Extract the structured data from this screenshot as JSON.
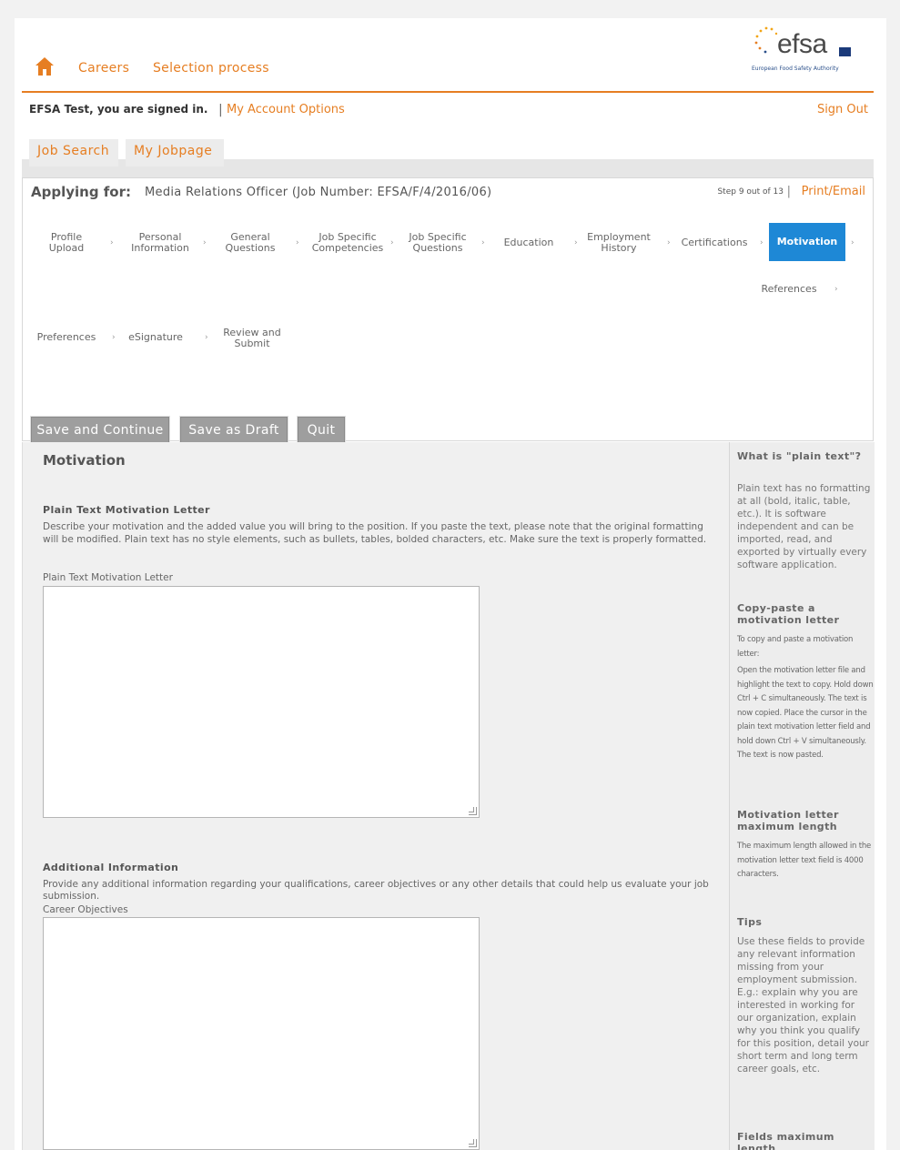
{
  "header": {
    "nav": [
      "Careers",
      "Selection process"
    ],
    "logo": {
      "word": "efsa",
      "subtitle": "European Food Safety Authority"
    }
  },
  "account": {
    "signed_in": "EFSA Test, you are signed in.",
    "separator": "|",
    "options": "My Account Options",
    "sign_out": "Sign Out"
  },
  "tabs": [
    "Job Search",
    "My Jobpage"
  ],
  "application": {
    "applying_label": "Applying for:",
    "applying_value": "Media Relations Officer (Job Number: EFSA/F/4/2016/06)",
    "step_count": "Step 9 out of 13",
    "print_sep": "|",
    "print_email": "Print/Email",
    "steps": [
      "Profile Upload",
      "Personal Information",
      "General Questions",
      "Job Specific Competencies",
      "Job Specific Questions",
      "Education",
      "Employment History",
      "Certifications",
      "Motivation",
      "References",
      "Preferences",
      "eSignature",
      "Review and Submit"
    ],
    "active_step": "Motivation",
    "buttons": {
      "save_continue": "Save and Continue",
      "save_draft": "Save as Draft",
      "quit": "Quit"
    }
  },
  "form": {
    "section_title": "Motivation",
    "motivation_heading": "Plain Text Motivation Letter",
    "motivation_desc": "Describe your motivation and the added value you will bring to the position. If you paste the text, please note that the original formatting will be modified. Plain text has no style elements, such as bullets, tables, bolded characters, etc. Make sure the text is properly formatted.",
    "motivation_label": "Plain Text Motivation Letter",
    "motivation_value": "",
    "additional_heading": "Additional Information",
    "additional_desc": "Provide any additional information regarding your qualifications, career objectives or any other details that could help us evaluate your job submission.",
    "career_label": "Career Objectives",
    "career_value": ""
  },
  "sidebar": {
    "h1": "What is \"plain text\"?",
    "p1": "Plain text has no formatting at all (bold, italic, table, etc.). It is software independent and can be imported, read, and exported by virtually every software application.",
    "h2": "Copy-paste a motivation letter",
    "p2a": "To copy and paste a motivation letter:",
    "p2b": "Open the motivation letter file and highlight the text to copy. Hold down Ctrl + C simultaneously. The text is now copied. Place the cursor in the plain text motivation letter field and hold down Ctrl + V simultaneously. The text is now pasted.",
    "h3": "Motivation letter maximum length",
    "p3": "The maximum length allowed in the motivation letter text field is 4000 characters.",
    "h4": "Tips",
    "p4": "Use these fields to provide any relevant information missing from your employment submission. E.g.: explain why you are interested in working for our organization, explain why you think you qualify for this position, detail your short term and long term career goals, etc.",
    "h5": "Fields maximum length"
  },
  "colors": {
    "accent": "#e67e22",
    "active_step": "#1e88d6",
    "button": "#9e9e9e"
  }
}
